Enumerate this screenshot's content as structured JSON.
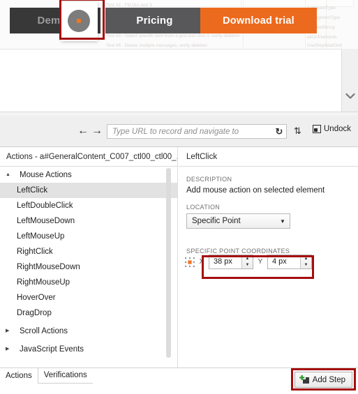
{
  "preview": {
    "nav_buttons": [
      {
        "label": "Demos",
        "name": "demos-button"
      },
      {
        "label": "Pricing",
        "name": "pricing-button"
      },
      {
        "label": "Download trial",
        "name": "download-trial-button"
      }
    ],
    "ghost_lines": [
      "Test #2 - Fill Out and S",
      "Test #3 - Select specific item from a grid and click it, verify deletion",
      "Test #6 - Delete multiple messages, verify deletion",
      "CompareType",
      "agSegmentType",
      "xpectedString",
      "aitOnElements",
      "UseStepWaitOnE"
    ],
    "colors": {
      "accent_orange": "#ec6a1d",
      "highlight_red": "#a50d0d",
      "nav_dark": "#383838",
      "nav_grey": "#58585a"
    }
  },
  "toolbar": {
    "back_icon": "arrow-left-icon",
    "forward_icon": "arrow-right-icon",
    "url_placeholder": "Type URL to record and navigate to",
    "url_value": "",
    "reload_icon": "reload-icon",
    "swap_icon": "swap-icon",
    "undock_label": "Undock"
  },
  "headers": {
    "left": "Actions - a#GeneralContent_C007_ctl00_ctl00_...",
    "right": "LeftClick"
  },
  "tree": {
    "groups": [
      {
        "label": "Mouse Actions",
        "expanded": true,
        "tri": "▲",
        "items": [
          {
            "label": "LeftClick",
            "selected": true
          },
          {
            "label": "LeftDoubleClick",
            "selected": false
          },
          {
            "label": "LeftMouseDown",
            "selected": false
          },
          {
            "label": "LeftMouseUp",
            "selected": false
          },
          {
            "label": "RightClick",
            "selected": false
          },
          {
            "label": "RightMouseDown",
            "selected": false
          },
          {
            "label": "RightMouseUp",
            "selected": false
          },
          {
            "label": "HoverOver",
            "selected": false
          },
          {
            "label": "DragDrop",
            "selected": false
          }
        ]
      },
      {
        "label": "Scroll Actions",
        "expanded": false,
        "tri": "▶",
        "items": []
      },
      {
        "label": "JavaScript Events",
        "expanded": false,
        "tri": "▶",
        "items": []
      }
    ]
  },
  "detail": {
    "description_label": "DESCRIPTION",
    "description_value": "Add mouse action on selected element",
    "location_label": "LOCATION",
    "location_value": "Specific Point",
    "location_options": [
      "Specific Point"
    ],
    "coordinates_label": "SPECIFIC POINT COORDINATES",
    "anchor_icon": "anchor-point-icon",
    "x_axis_label": "X",
    "x_value": "38 px",
    "y_axis_label": "Y",
    "y_value": "4 px",
    "spinner_up": "▲",
    "spinner_down": "▼"
  },
  "bottom": {
    "tabs": [
      {
        "label": "Actions",
        "active": true
      },
      {
        "label": "Verifications",
        "active": false
      }
    ],
    "add_step_label": "Add Step",
    "add_step_icon": "add-step-icon"
  }
}
